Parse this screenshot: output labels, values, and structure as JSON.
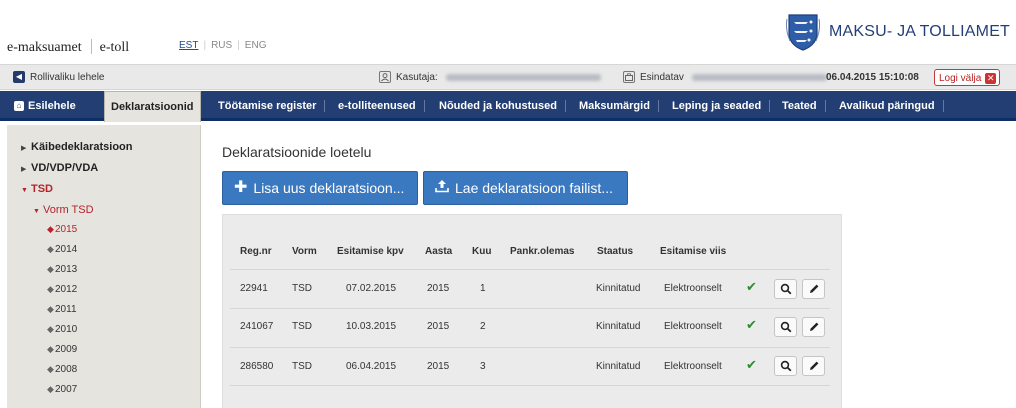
{
  "header": {
    "brand_primary": "e-maksuamet",
    "brand_secondary": "e-toll",
    "languages": [
      {
        "code": "EST",
        "active": true
      },
      {
        "code": "RUS",
        "active": false
      },
      {
        "code": "ENG",
        "active": false
      }
    ],
    "agency_name": "MAKSU- JA TOLLIAMET"
  },
  "userbar": {
    "role_link": "Rollivaliku lehele",
    "user_label": "Kasutaja:",
    "representative_label": "Esindatav",
    "datetime": "06.04.2015 15:10:08",
    "logout_label": "Logi välja"
  },
  "nav": {
    "items": [
      {
        "label": "Esilehele"
      },
      {
        "label": "Deklaratsioonid",
        "active": true
      },
      {
        "label": "Töötamise register"
      },
      {
        "label": "e-tolliteenused"
      },
      {
        "label": "Nõuded ja kohustused"
      },
      {
        "label": "Maksumärgid"
      },
      {
        "label": "Leping ja seaded"
      },
      {
        "label": "Teated"
      },
      {
        "label": "Avalikud päringud"
      }
    ]
  },
  "sidebar": {
    "items": [
      {
        "label": "Käibedeklaratsioon",
        "level": 1
      },
      {
        "label": "VD/VDP/VDA",
        "level": 1
      },
      {
        "label": "TSD",
        "level": 1,
        "expanded": true
      },
      {
        "label": "Vorm TSD",
        "level": 2,
        "expanded": true
      }
    ],
    "years": [
      "2015",
      "2014",
      "2013",
      "2012",
      "2011",
      "2010",
      "2009",
      "2008",
      "2007"
    ],
    "active_year": "2015"
  },
  "main": {
    "title": "Deklaratsioonide loetelu",
    "add_button": "Lisa uus deklaratsioon...",
    "upload_button": "Lae deklaratsioon failist...",
    "columns": [
      "Reg.nr",
      "Vorm",
      "Esitamise kpv",
      "Aasta",
      "Kuu",
      "Pankr.olemas",
      "Staatus",
      "Esitamise viis"
    ],
    "rows": [
      {
        "reg": "22941",
        "vorm": "TSD",
        "kpv": "07.02.2015",
        "aasta": "2015",
        "kuu": "1",
        "pankr": "",
        "staatus": "Kinnitatud",
        "viis": "Elektroonselt"
      },
      {
        "reg": "241067",
        "vorm": "TSD",
        "kpv": "10.03.2015",
        "aasta": "2015",
        "kuu": "2",
        "pankr": "",
        "staatus": "Kinnitatud",
        "viis": "Elektroonselt"
      },
      {
        "reg": "286580",
        "vorm": "TSD",
        "kpv": "06.04.2015",
        "aasta": "2015",
        "kuu": "3",
        "pankr": "",
        "staatus": "Kinnitatud",
        "viis": "Elektroonselt"
      }
    ]
  },
  "colors": {
    "nav_bg": "#233e72",
    "accent_red": "#b3242c",
    "button_blue": "#3a78c0",
    "check_green": "#2e8b30"
  },
  "icons": [
    "coat-of-arms-logo",
    "back-icon",
    "user-icon",
    "briefcase-icon",
    "close-icon",
    "home-icon",
    "plus-icon",
    "upload-icon",
    "check-icon",
    "search-icon",
    "edit-icon"
  ]
}
